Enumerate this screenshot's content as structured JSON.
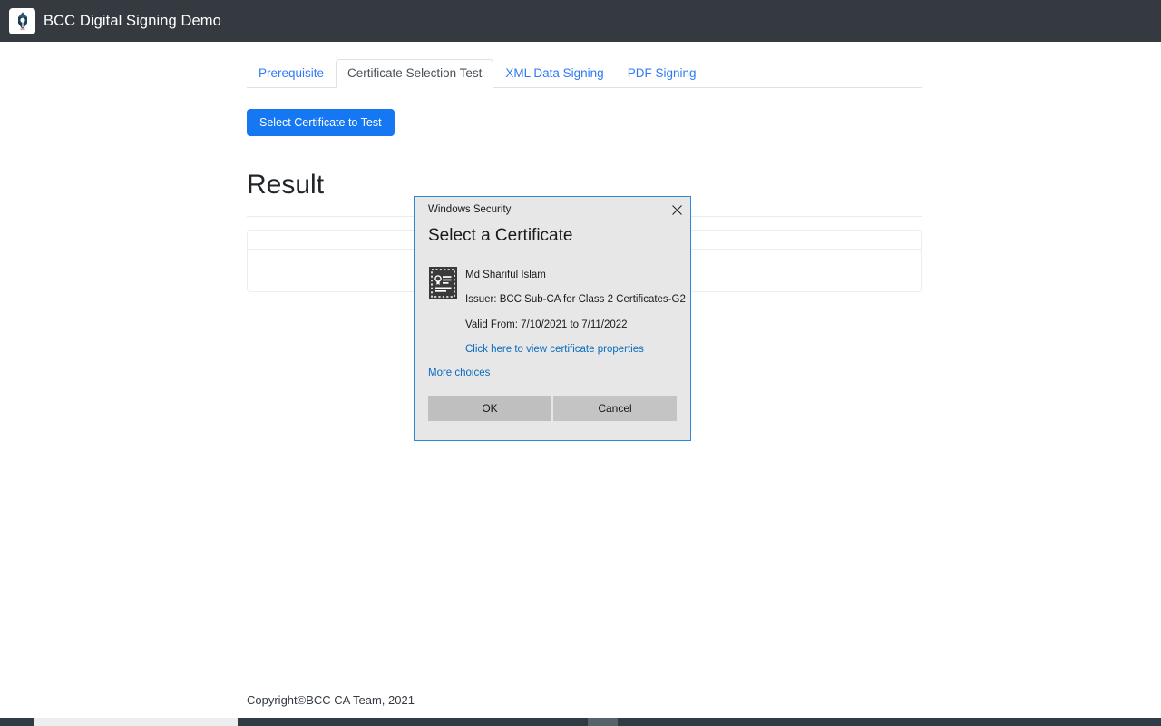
{
  "navbar": {
    "brand_title": "BCC Digital Signing Demo",
    "logo_icon": "pen-nib-icon",
    "background_color": "#343a40"
  },
  "tabs": [
    {
      "label": "Prerequisite",
      "active": false
    },
    {
      "label": "Certificate Selection Test",
      "active": true
    },
    {
      "label": "XML Data Signing",
      "active": false
    },
    {
      "label": "PDF Signing",
      "active": false
    }
  ],
  "main": {
    "select_certificate_button": "Select Certificate to Test",
    "result_heading": "Result",
    "table": {
      "header_cells": [
        ""
      ],
      "rows": [
        [
          ""
        ]
      ]
    }
  },
  "footer": {
    "copyright": "Copyright©BCC CA Team, 2021"
  },
  "dialog": {
    "titlebar": "Windows Security",
    "close_icon": "close-icon",
    "heading": "Select a Certificate",
    "certificate": {
      "icon": "certificate-icon",
      "subject": "Md Shariful Islam",
      "issuer": "Issuer: BCC Sub-CA for Class 2 Certificates-G2",
      "validity": "Valid From: 7/10/2021 to 7/11/2022",
      "properties_link": "Click here to view certificate properties"
    },
    "more_choices": "More choices",
    "ok_button": "OK",
    "cancel_button": "Cancel",
    "border_color": "#2b88d8",
    "background_color": "#e7e7e7"
  },
  "colors": {
    "primary_button": "#1577f2",
    "link": "#2e7bf6",
    "dialog_link": "#0a6cbf"
  }
}
